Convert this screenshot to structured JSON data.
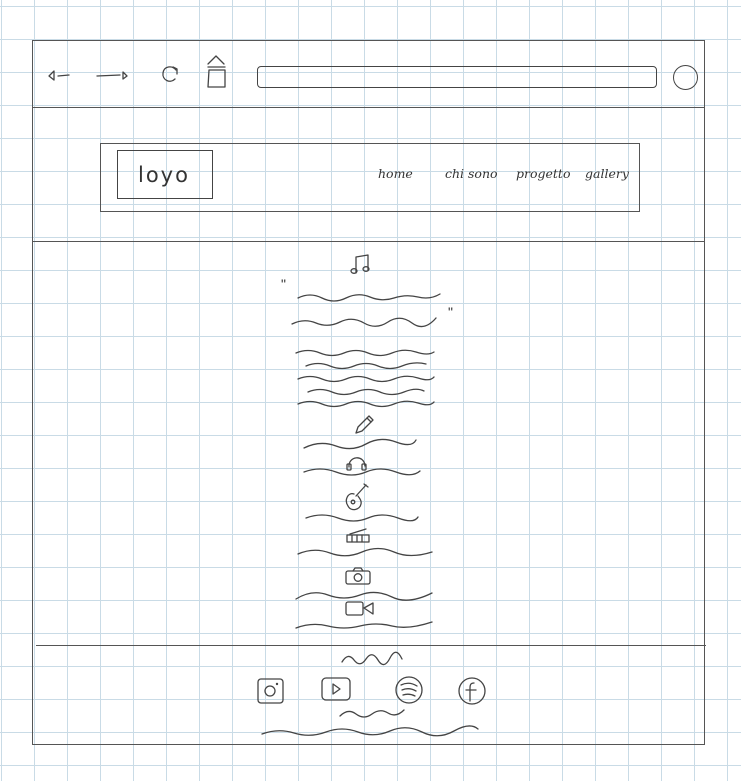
{
  "logo": {
    "text": "loyo"
  },
  "nav": {
    "items": [
      {
        "label": "home"
      },
      {
        "label": "chi sono"
      },
      {
        "label": "progetto"
      },
      {
        "label": "gallery"
      }
    ]
  },
  "main": {
    "quote": {
      "open": "\"",
      "close": "\""
    }
  },
  "icons": {
    "browser": [
      "back-arrow-icon",
      "forward-arrow-icon",
      "reload-icon",
      "share-icon",
      "profile-icon"
    ],
    "skills": [
      "music-note-icon",
      "pencil-icon",
      "headphones-icon",
      "guitar-icon",
      "piano-icon",
      "camera-icon",
      "video-camera-icon"
    ],
    "social": [
      "instagram-icon",
      "youtube-icon",
      "spotify-icon",
      "facebook-icon"
    ]
  },
  "colors": {
    "ink": "#444444",
    "grid": "#c9dbe6",
    "paper": "#ffffff"
  }
}
